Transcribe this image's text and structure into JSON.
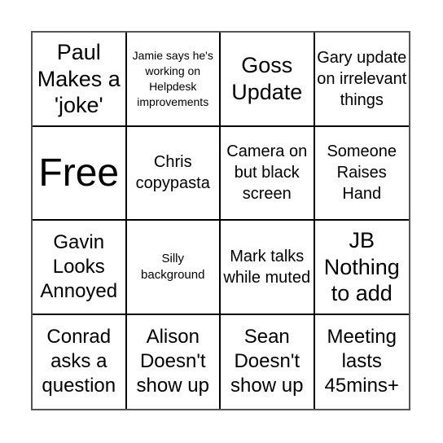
{
  "bingo": {
    "columns": 4,
    "rows": 4,
    "cells": [
      {
        "text": "Paul Makes a 'joke'",
        "size": "l"
      },
      {
        "text": "Jamie says he's working on Helpdesk improvements",
        "size": "xxs"
      },
      {
        "text": "Goss Update",
        "size": "l"
      },
      {
        "text": "Gary update on irrelevant things",
        "size": "s"
      },
      {
        "text": "Free",
        "size": "xl"
      },
      {
        "text": "Chris copypasta",
        "size": "s"
      },
      {
        "text": "Camera on but black screen",
        "size": "s"
      },
      {
        "text": "Someone Raises Hand",
        "size": "s"
      },
      {
        "text": "Gavin Looks Annoyed",
        "size": "m"
      },
      {
        "text": "Silly background",
        "size": "xs"
      },
      {
        "text": "Mark talks while muted",
        "size": "s"
      },
      {
        "text": "JB Nothing to add",
        "size": "l"
      },
      {
        "text": "Conrad asks a question",
        "size": "m"
      },
      {
        "text": "Alison Doesn't show up",
        "size": "m"
      },
      {
        "text": "Sean Doesn't show up",
        "size": "m"
      },
      {
        "text": "Meeting lasts 45mins+",
        "size": "m"
      }
    ]
  }
}
